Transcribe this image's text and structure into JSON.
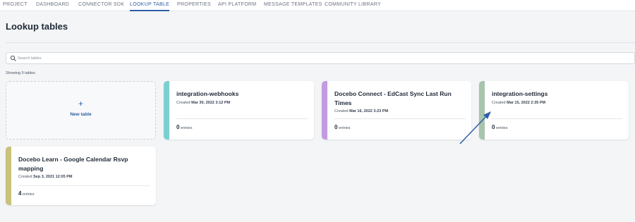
{
  "colors": {
    "accent": "#2c5fa8",
    "stripe_teal": "#7ccfd0",
    "stripe_purple": "#c39be0",
    "stripe_sage": "#a8c4ac",
    "stripe_olive": "#c9c27a"
  },
  "tabs": [
    {
      "label": "PROJECT",
      "active": false
    },
    {
      "label": "DASHBOARD",
      "active": false
    },
    {
      "label": "CONNECTOR SDK",
      "active": false
    },
    {
      "label": "LOOKUP TABLE",
      "active": true
    },
    {
      "label": "PROPERTIES",
      "active": false
    },
    {
      "label": "API PLATFORM",
      "active": false
    },
    {
      "label": "MESSAGE TEMPLATES",
      "active": false
    },
    {
      "label": "COMMUNITY LIBRARY",
      "active": false
    }
  ],
  "page": {
    "title": "Lookup tables"
  },
  "search": {
    "placeholder": "Search tables",
    "value": "",
    "icon": "search-icon"
  },
  "results": {
    "showing": "Showing 5 tables"
  },
  "new_table": {
    "plus": "+",
    "label": "New table"
  },
  "cards": [
    {
      "title": "integration-webhooks",
      "created_prefix": "Created",
      "created_date": "Mar 30, 2022 3:12 PM",
      "entries_count": "0",
      "entries_label": "entries"
    },
    {
      "title": "Docebo Connect - EdCast Sync Last Run Times",
      "created_prefix": "Created",
      "created_date": "Mar 16, 2022 3:23 PM",
      "entries_count": "0",
      "entries_label": "entries"
    },
    {
      "title": "integration-settings",
      "created_prefix": "Created",
      "created_date": "Mar 15, 2022 2:35 PM",
      "entries_count": "0",
      "entries_label": "entries"
    },
    {
      "title": "Docebo Learn - Google Calendar Rsvp mapping",
      "created_prefix": "Created",
      "created_date": "Sep 3, 2021 12:05 PM",
      "entries_count": "4",
      "entries_label": "entries"
    }
  ]
}
